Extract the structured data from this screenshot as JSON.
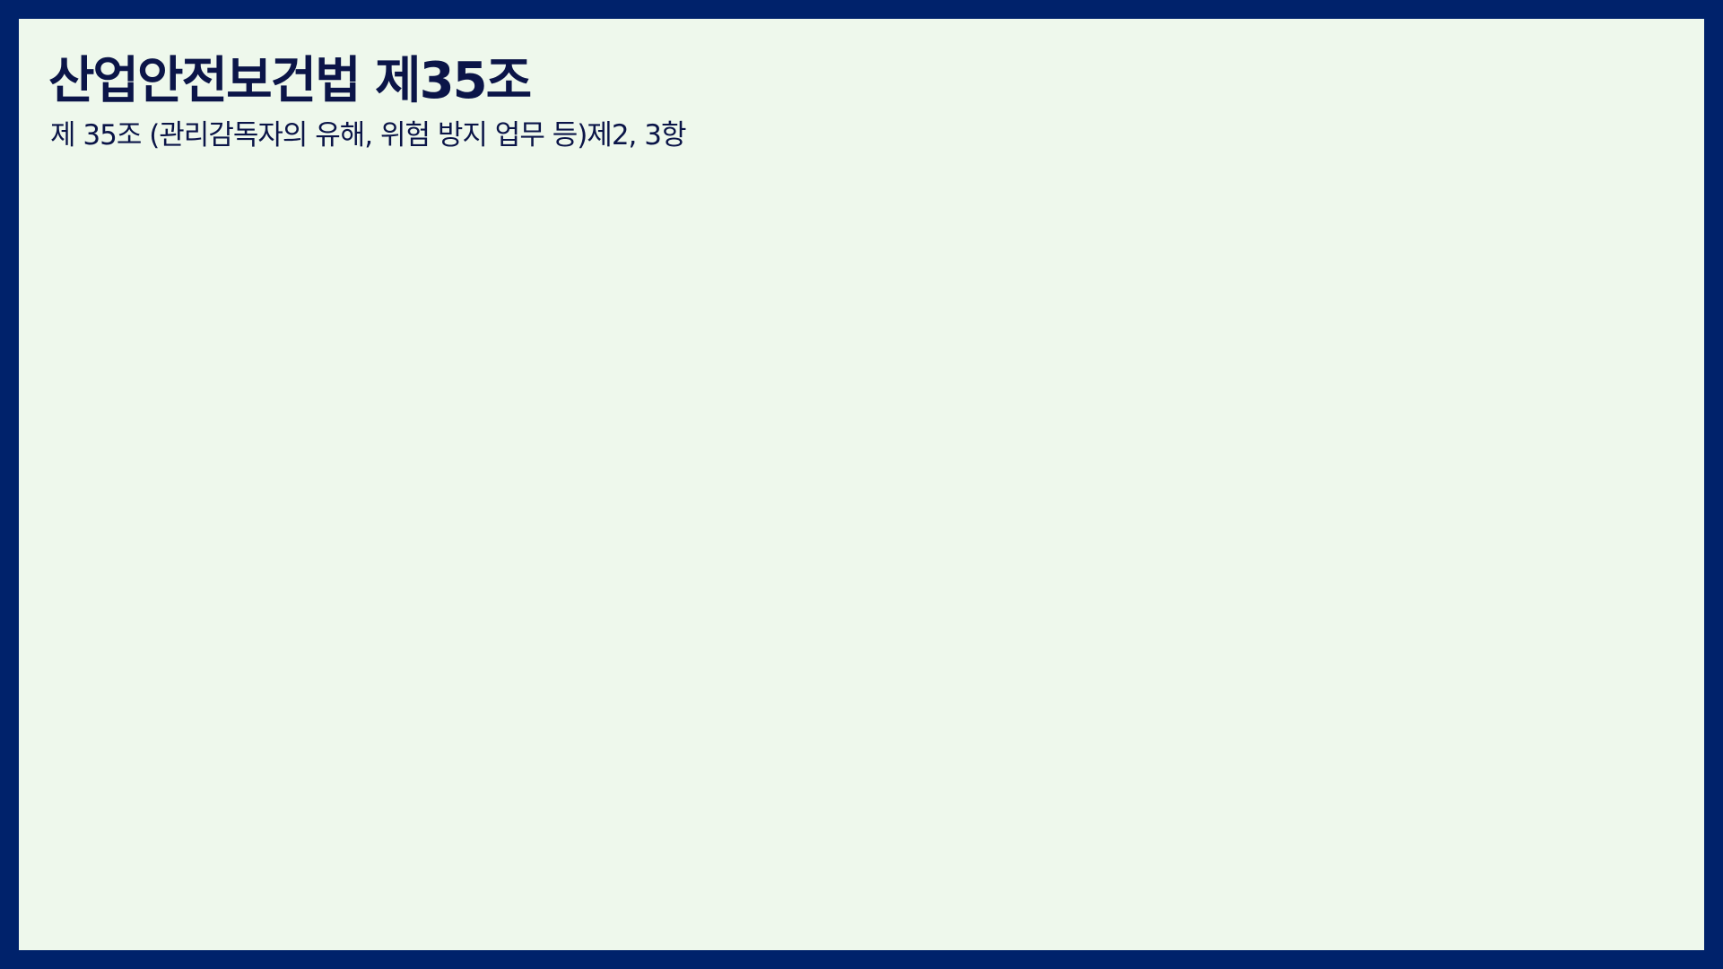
{
  "slide": {
    "title": "산업안전보건법 제35조",
    "subtitle": "제 35조 (관리감독자의 유해, 위험 방지 업무 등)제2, 3항"
  },
  "colors": {
    "border": "#00226b",
    "background": "#eef8ec",
    "text": "#0b1548"
  }
}
